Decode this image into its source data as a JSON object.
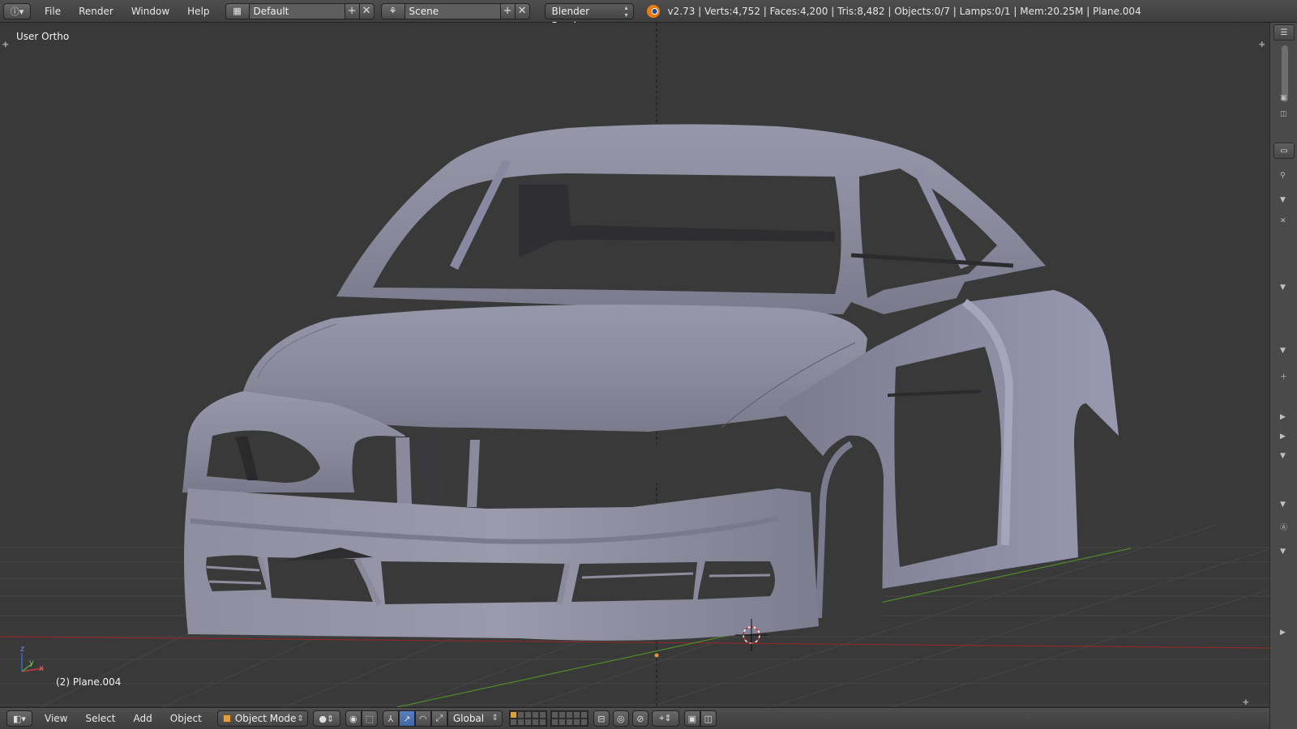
{
  "top_header": {
    "menus": [
      "File",
      "Render",
      "Window",
      "Help"
    ],
    "screen_layout": "Default",
    "scene": "Scene",
    "render_engine": "Blender Render",
    "stats": "v2.73 | Verts:4,752 | Faces:4,200 | Tris:8,482 | Objects:0/7 | Lamps:0/1 | Mem:20.25M | Plane.004"
  },
  "viewport": {
    "view_label": "User Ortho",
    "object_label": "(2) Plane.004",
    "axis_x": "x",
    "axis_y": "y",
    "axis_z": "z",
    "colors": {
      "background": "#393939",
      "grid": "#454545",
      "x_axis": "#8a2a2a",
      "y_axis": "#4f8a2a",
      "mesh": "#8d8da0",
      "mesh_shadow": "#5e5e6a"
    }
  },
  "bottom_header": {
    "menus": [
      "View",
      "Select",
      "Add",
      "Object"
    ],
    "mode": "Object Mode",
    "transform_orientation": "Global"
  },
  "icons": [
    "info-editor-icon",
    "layout-icon",
    "scene-icon",
    "blender-logo-icon",
    "cube-icon",
    "solid-shading-icon",
    "pivot-icon",
    "manipulator-icon",
    "translate-icon",
    "rotate-icon",
    "scale-icon",
    "render-icon",
    "camera-icon"
  ]
}
